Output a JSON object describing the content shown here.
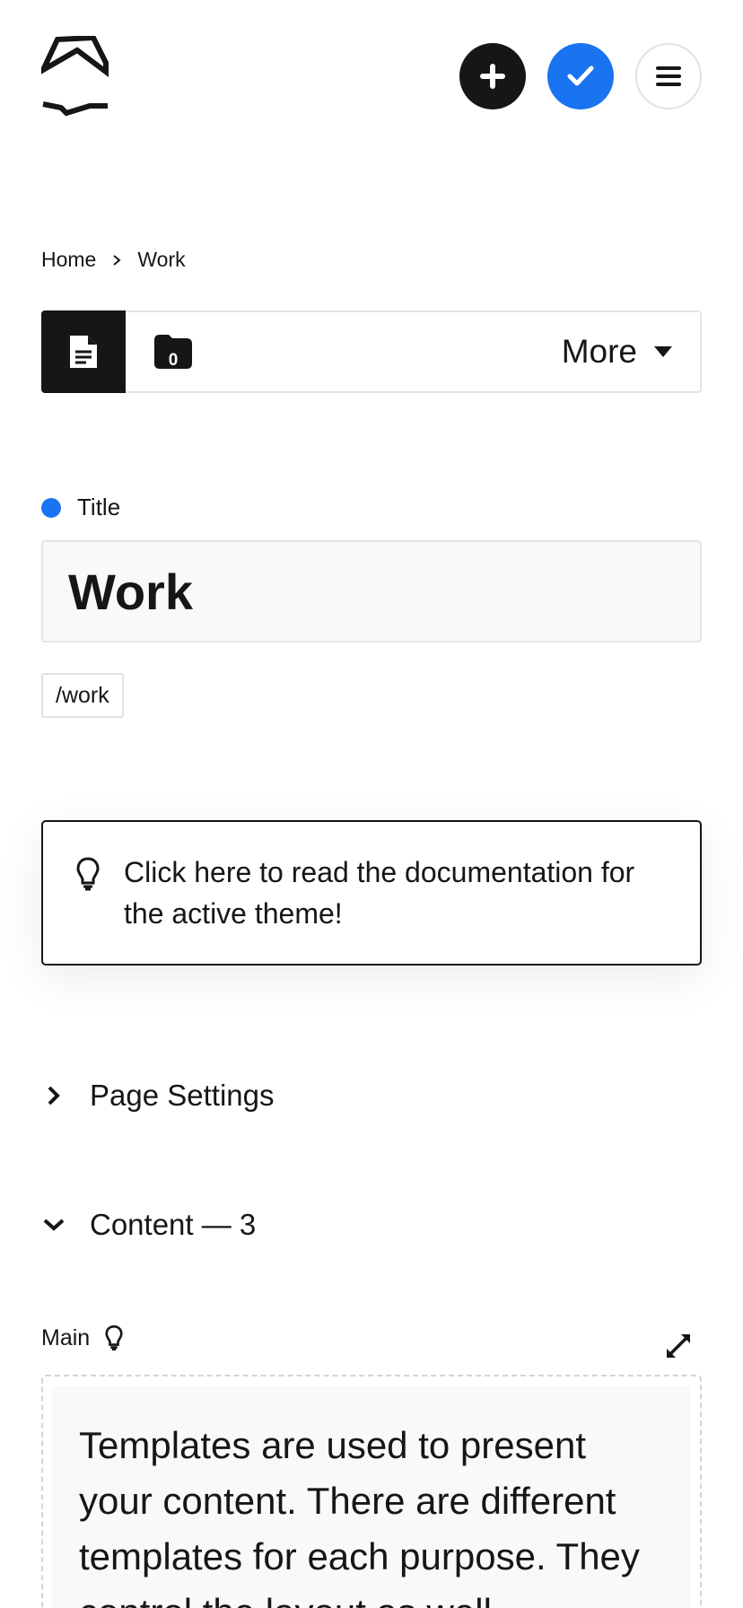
{
  "header": {
    "logo_icon": "panel-logo-icon",
    "add_icon": "plus-icon",
    "save_icon": "check-icon",
    "menu_icon": "hamburger-icon",
    "colors": {
      "dark": "#161616",
      "accent": "#1a73f0"
    }
  },
  "breadcrumb": {
    "items": [
      {
        "label": "Home"
      },
      {
        "label": "Work"
      }
    ],
    "separator_icon": "chevron-right-icon"
  },
  "toolbar": {
    "doc_icon": "document-icon",
    "folder_icon": "folder-icon",
    "folder_count": "0",
    "more_label": "More",
    "more_icon": "caret-down-icon"
  },
  "title_field": {
    "label": "Title",
    "value": "Work",
    "slug": "/work"
  },
  "info": {
    "icon": "lightbulb-icon",
    "text": "Click here to read the documentation for the active theme!"
  },
  "sections": [
    {
      "label": "Page Settings",
      "expanded": false
    },
    {
      "label": "Content — 3",
      "expanded": true
    }
  ],
  "main_field": {
    "label": "Main",
    "hint_icon": "lightbulb-icon",
    "expand_icon": "expand-icon",
    "text": "Templates are used to present your content. There are different templates for each purpose. They control the layout as well"
  }
}
